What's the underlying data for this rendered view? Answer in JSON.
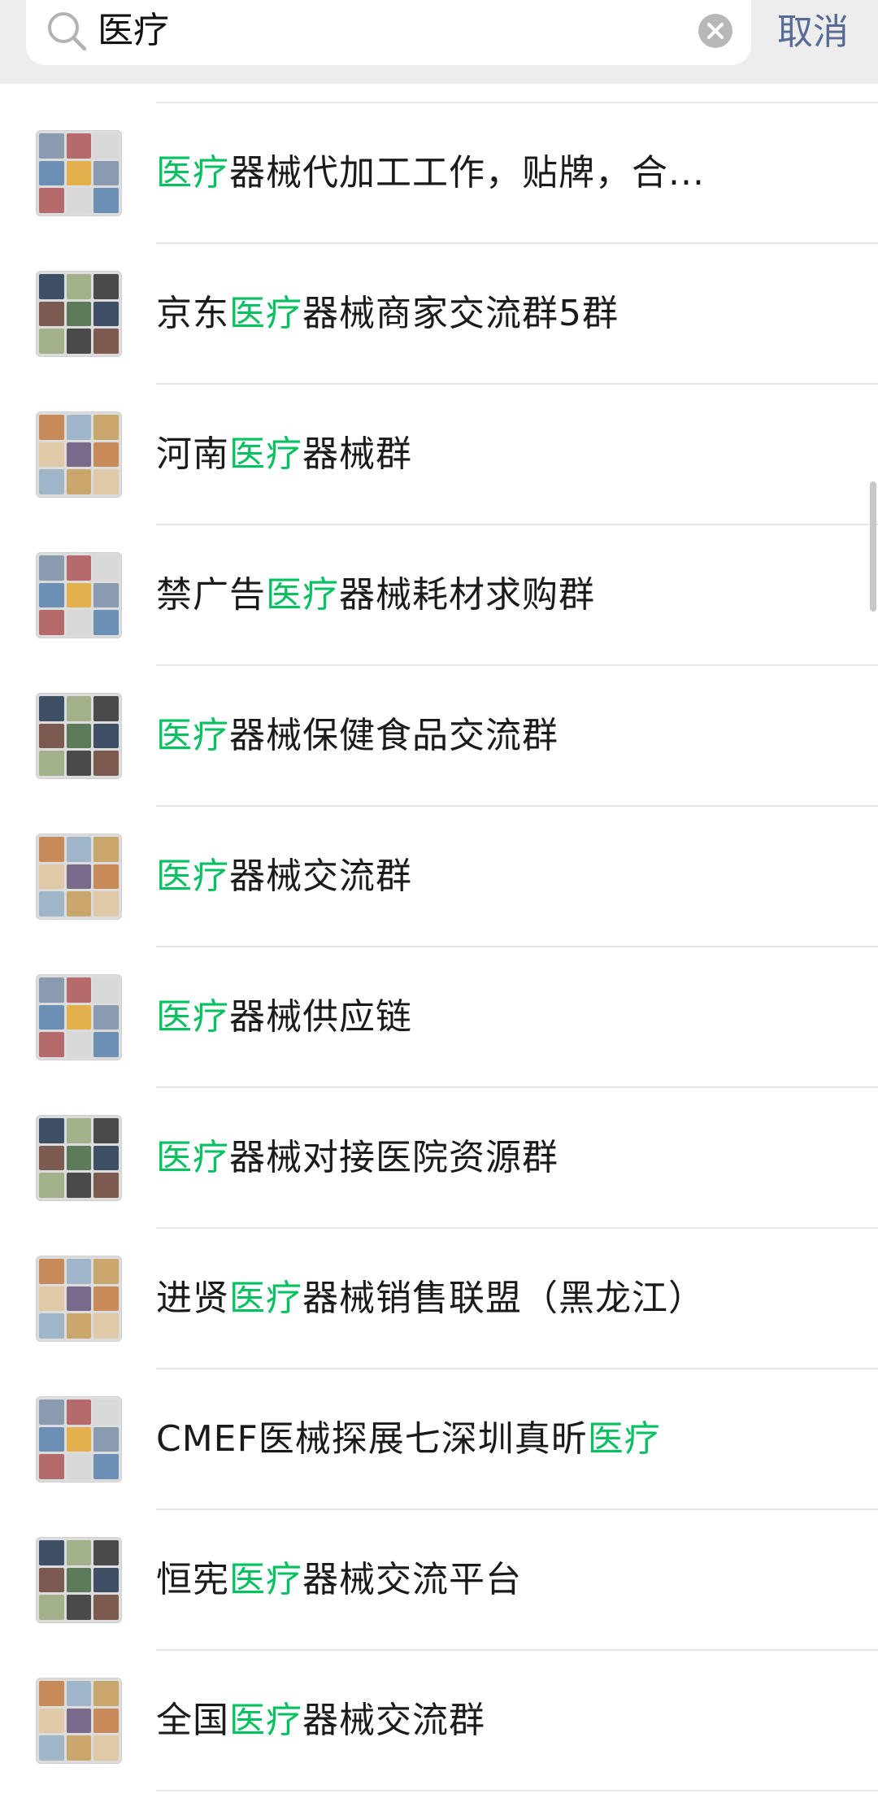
{
  "search": {
    "query": "医疗",
    "cancel_label": "取消"
  },
  "highlight_color": "#07c160",
  "results": [
    {
      "pre": "",
      "hl": "医疗",
      "post": "器械代加工工作，贴牌，合..."
    },
    {
      "pre": "京东",
      "hl": "医疗",
      "post": "器械商家交流群5群"
    },
    {
      "pre": "河南",
      "hl": "医疗",
      "post": "器械群"
    },
    {
      "pre": "禁广告",
      "hl": "医疗",
      "post": "器械耗材求购群"
    },
    {
      "pre": "",
      "hl": "医疗",
      "post": "器械保健食品交流群"
    },
    {
      "pre": "",
      "hl": "医疗",
      "post": "器械交流群"
    },
    {
      "pre": "",
      "hl": "医疗",
      "post": "器械供应链"
    },
    {
      "pre": "",
      "hl": "医疗",
      "post": "器械对接医院资源群"
    },
    {
      "pre": "进贤",
      "hl": "医疗",
      "post": "器械销售联盟（黑龙江）"
    },
    {
      "pre": "CMEF医械探展七深圳真昕",
      "hl": "医疗",
      "post": ""
    },
    {
      "pre": "恒宪",
      "hl": "医疗",
      "post": "器械交流平台"
    },
    {
      "pre": "全国",
      "hl": "医疗",
      "post": "器械交流群"
    }
  ]
}
